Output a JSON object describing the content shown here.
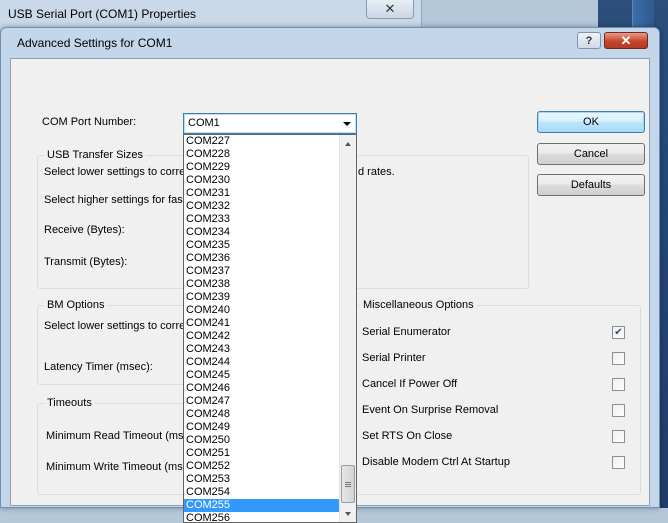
{
  "parent_window": {
    "title": "USB Serial Port (COM1) Properties"
  },
  "dialog": {
    "title": "Advanced Settings for COM1",
    "help": "?",
    "close": "✕"
  },
  "com_port": {
    "label": "COM Port Number:",
    "value": "COM1"
  },
  "dropdown": {
    "items": [
      "COM227",
      "COM228",
      "COM229",
      "COM230",
      "COM231",
      "COM232",
      "COM233",
      "COM234",
      "COM235",
      "COM236",
      "COM237",
      "COM238",
      "COM239",
      "COM240",
      "COM241",
      "COM242",
      "COM243",
      "COM244",
      "COM245",
      "COM246",
      "COM247",
      "COM248",
      "COM249",
      "COM250",
      "COM251",
      "COM252",
      "COM253",
      "COM254",
      "COM255",
      "COM256"
    ],
    "selected": "COM255"
  },
  "buttons": {
    "ok": "OK",
    "cancel": "Cancel",
    "defaults": "Defaults"
  },
  "usb_transfer": {
    "title": "USB Transfer Sizes",
    "line1_left": "Select lower settings to corre",
    "line1_right": "d rates.",
    "line2": "Select higher settings for fas",
    "receive": "Receive (Bytes):",
    "transmit": "Transmit (Bytes):"
  },
  "bm_options": {
    "title": "BM Options",
    "line1": "Select lower settings to corre",
    "latency": "Latency Timer (msec):"
  },
  "timeouts": {
    "title": "Timeouts",
    "read": "Minimum Read Timeout (msec",
    "write": "Minimum Write Timeout (mse"
  },
  "misc": {
    "title": "Miscellaneous Options",
    "options": [
      {
        "label": "Serial Enumerator",
        "checked": true
      },
      {
        "label": "Serial Printer",
        "checked": false
      },
      {
        "label": "Cancel If Power Off",
        "checked": false
      },
      {
        "label": "Event On Surprise Removal",
        "checked": false
      },
      {
        "label": "Set RTS On Close",
        "checked": false
      },
      {
        "label": "Disable Modem Ctrl At Startup",
        "checked": false
      }
    ]
  },
  "colors": {
    "selection": "#3399ff",
    "dialog_frame": "#c4d6e9",
    "close_button": "#c8452e"
  },
  "icons": {
    "checkmark": "checkmark-icon",
    "dropdown_arrow": "chevron-down-icon",
    "scroll_up": "scroll-up-icon",
    "scroll_down": "scroll-down-icon"
  }
}
